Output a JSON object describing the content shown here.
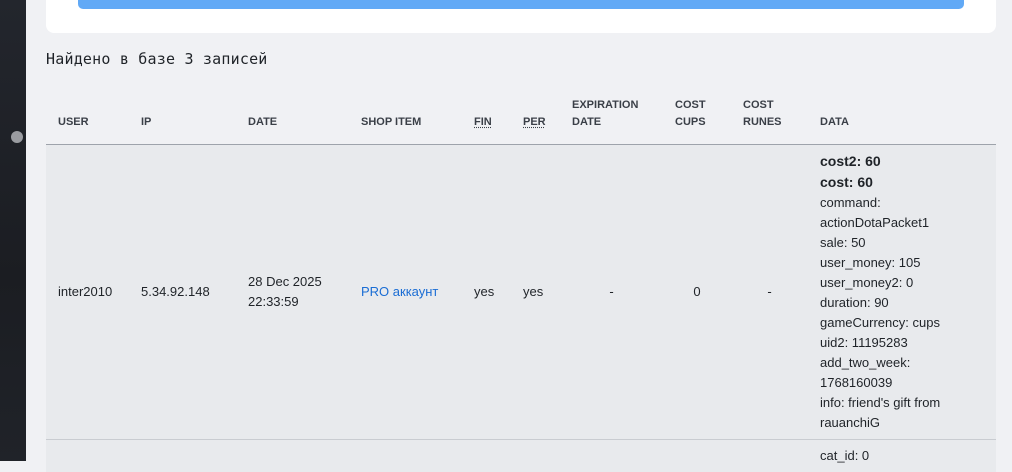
{
  "heading": "Найдено в базе 3 записей",
  "columns": {
    "user": "USER",
    "ip": "IP",
    "date": "DATE",
    "shop_item": "SHOP ITEM",
    "fin": "FIN",
    "per": "PER",
    "expiration_line1": "EXPIRATION",
    "expiration_line2": "DATE",
    "cost_cups_line1": "COST",
    "cost_cups_line2": "CUPS",
    "cost_runes_line1": "COST",
    "cost_runes_line2": "RUNES",
    "data": "DATA"
  },
  "rows": [
    {
      "user": "inter2010",
      "ip": "5.34.92.148",
      "date_line1": "28 Dec 2025",
      "date_line2": "22:33:59",
      "shop_item": "PRO аккаунт",
      "fin": "yes",
      "per": "yes",
      "expiration": "-",
      "cost_cups": "0",
      "cost_runes": "-",
      "data": [
        "cost2: 60",
        "cost: 60",
        "command:",
        "actionDotaPacket1",
        "sale: 50",
        "user_money: 105",
        "user_money2: 0",
        "duration: 90",
        "gameCurrency: cups",
        "uid2: 11195283",
        "add_two_week:",
        "1768160039",
        "info: friend's gift from",
        "rauanchiG"
      ]
    },
    {
      "data_first": "cat_id: 0"
    }
  ],
  "colors": {
    "accent_bar": "#61a9f6",
    "link": "#1a6dd4",
    "row_bg": "#e8eaed"
  }
}
